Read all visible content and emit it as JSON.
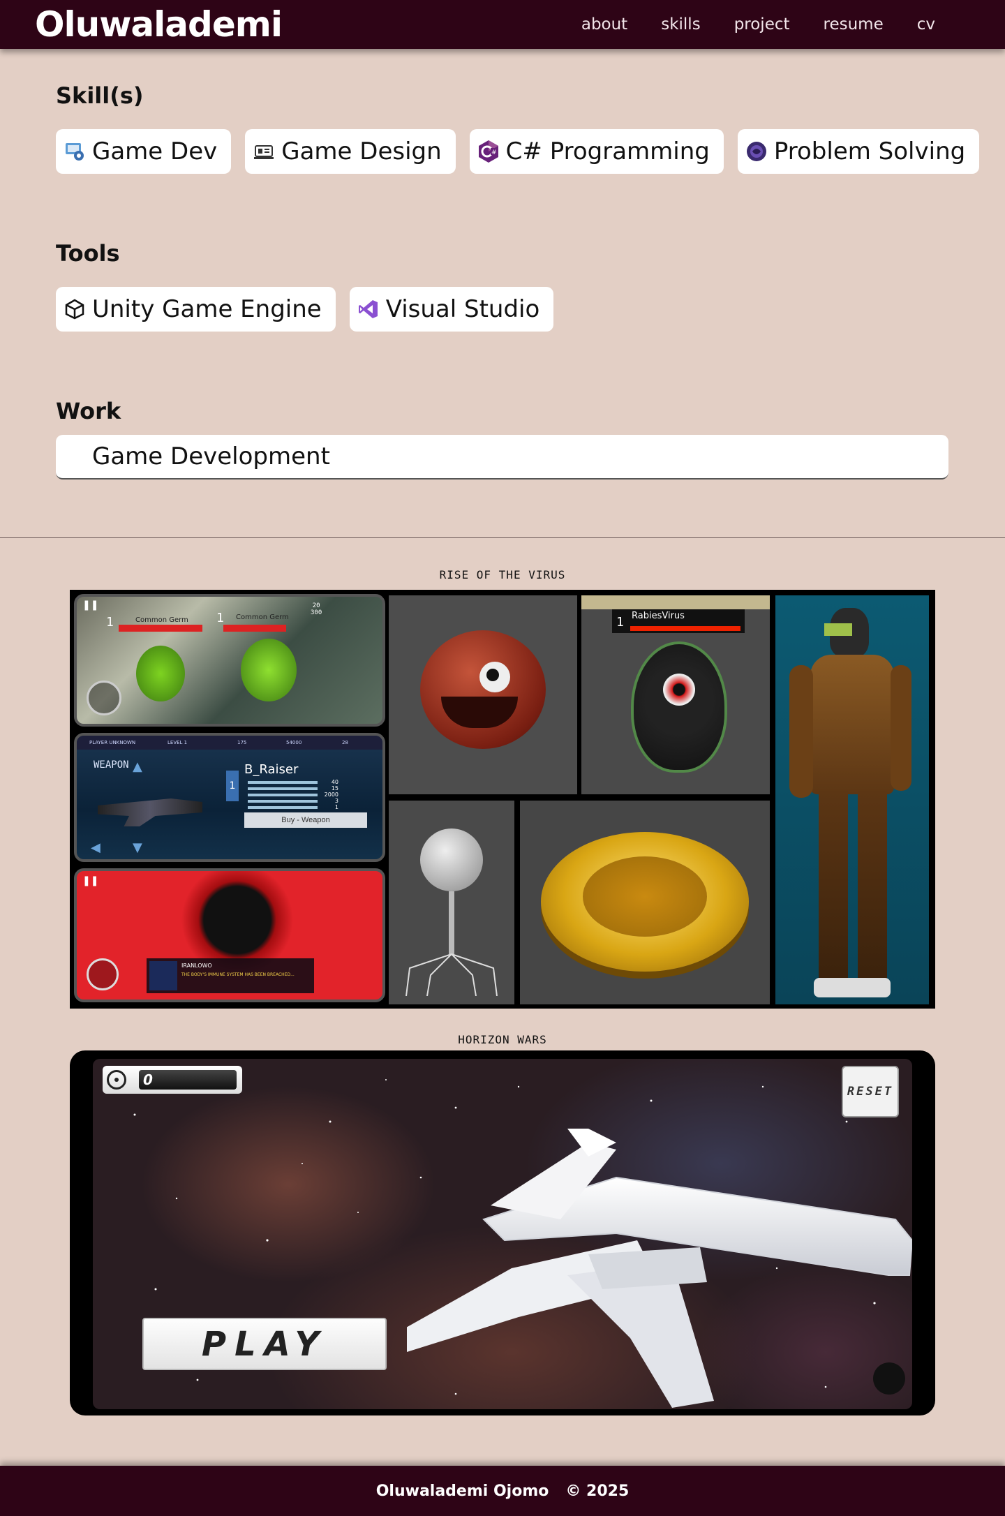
{
  "header": {
    "brand": "Oluwalademi",
    "nav": [
      "about",
      "skills",
      "project",
      "resume",
      "cv"
    ]
  },
  "skills": {
    "title": "Skill(s)",
    "items": [
      {
        "label": "Game Dev",
        "icon": "game-dev-icon"
      },
      {
        "label": "Game Design",
        "icon": "game-design-icon"
      },
      {
        "label": "C# Programming",
        "icon": "csharp-icon"
      },
      {
        "label": "Problem Solving",
        "icon": "problem-solving-icon"
      }
    ]
  },
  "tools": {
    "title": "Tools",
    "items": [
      {
        "label": "Unity Game Engine",
        "icon": "unity-icon"
      },
      {
        "label": "Visual Studio",
        "icon": "visual-studio-icon"
      }
    ]
  },
  "work": {
    "title": "Work",
    "tab": "Game Development"
  },
  "projects": [
    {
      "title": "RISE OF THE VIRUS",
      "shots": {
        "hud_count_1": "1",
        "hud_name_1": "Common Germ",
        "hud_count_2": "1",
        "hud_name_2": "Common Germ",
        "ammo": "20",
        "ammo_max": "300",
        "weapon_heading": "WEAPON",
        "player": "PLAYER UNKNOWN",
        "level": "LEVEL 1",
        "coins": "54000",
        "gems": "175",
        "shards": "28",
        "weapon_name": "B_Raiser",
        "weapon_slot": "1",
        "weapon_stats": [
          "40",
          "15",
          "2000",
          "3",
          "1"
        ],
        "buy_button": "Buy - Weapon",
        "boss_count": "1",
        "boss_name": "RabiesVirus",
        "dialog_name": "IRANLOWO",
        "dialog_text": "THE BODY'S IMMUNE SYSTEM HAS BEEN BREACHED..."
      }
    },
    {
      "title": "HORIZON WARS",
      "shots": {
        "score": "0",
        "reset_button": "RESET",
        "play_button": "PLAY"
      }
    }
  ],
  "footer": {
    "name": "Oluwalademi Ojomo",
    "copyright": "© 2025"
  },
  "colors": {
    "background": "#e3cfc5",
    "header": "#2e0416",
    "chip": "#ffffff"
  }
}
